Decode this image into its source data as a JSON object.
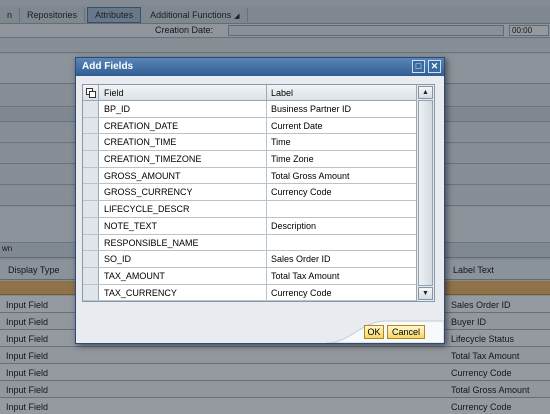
{
  "toolbar": {
    "items": [
      {
        "label": "n",
        "active": false
      },
      {
        "label": "Repositories",
        "active": false
      },
      {
        "label": "Attributes",
        "active": true
      },
      {
        "label": "Additional Functions",
        "active": false,
        "has_menu": true
      }
    ]
  },
  "header_fields": {
    "creation_date_label": "Creation Date:",
    "time_value": "00:00"
  },
  "background_panel": {
    "section_title": "wn",
    "columns": [
      "Display Type",
      "Label Text"
    ],
    "rows": [
      {
        "display_type": "Input Field",
        "label_text": "Sales Order ID"
      },
      {
        "display_type": "Input Field",
        "label_text": "Buyer ID"
      },
      {
        "display_type": "Input Field",
        "label_text": "Lifecycle Status"
      },
      {
        "display_type": "Input Field",
        "label_text": "Total Tax Amount"
      },
      {
        "display_type": "Input Field",
        "label_text": "Currency Code"
      },
      {
        "display_type": "Input Field",
        "label_text": "Total Gross Amount"
      },
      {
        "display_type": "Input Field",
        "label_text": "Currency Code"
      }
    ]
  },
  "dialog": {
    "title": "Add Fields",
    "columns": {
      "field": "Field",
      "label": "Label"
    },
    "rows": [
      {
        "field": "BP_ID",
        "label": "Business Partner ID"
      },
      {
        "field": "CREATION_DATE",
        "label": "Current Date"
      },
      {
        "field": "CREATION_TIME",
        "label": "Time"
      },
      {
        "field": "CREATION_TIMEZONE",
        "label": "Time Zone"
      },
      {
        "field": "GROSS_AMOUNT",
        "label": "Total Gross Amount"
      },
      {
        "field": "GROSS_CURRENCY",
        "label": "Currency Code"
      },
      {
        "field": "LIFECYCLE_DESCR",
        "label": ""
      },
      {
        "field": "NOTE_TEXT",
        "label": "Description"
      },
      {
        "field": "RESPONSIBLE_NAME",
        "label": ""
      },
      {
        "field": "SO_ID",
        "label": "Sales Order ID"
      },
      {
        "field": "TAX_AMOUNT",
        "label": "Total Tax Amount"
      },
      {
        "field": "TAX_CURRENCY",
        "label": "Currency Code"
      }
    ],
    "buttons": {
      "ok": "OK",
      "cancel": "Cancel"
    }
  },
  "colors": {
    "title_bar": "#2f5d93",
    "button_yellow": "#f5d664",
    "selection_orange": "#e6a854"
  },
  "icons": {
    "maximize": "maximize-icon",
    "close": "close-icon",
    "select_all": "select-all-icon"
  }
}
